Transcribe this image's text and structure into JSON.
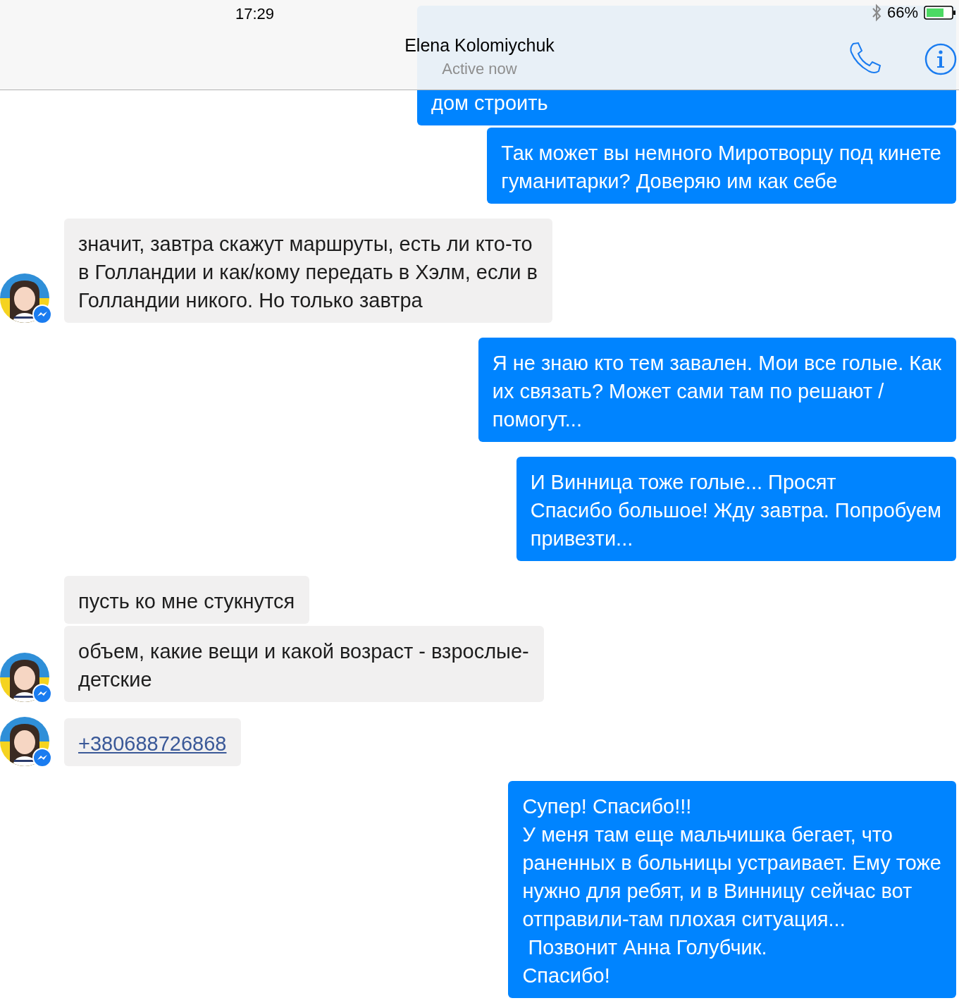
{
  "status_bar": {
    "time": "17:29",
    "battery": "66%"
  },
  "header": {
    "name": "Elena Kolomiychuk",
    "status": "Active now"
  },
  "groups": [
    {
      "kind": "outgoing",
      "messages": [
        {
          "kind": "text",
          "text": "дом строить"
        },
        {
          "kind": "text",
          "text": "Так может вы немного Миротворцу под кинете\nгуманитарки? Доверяю им как себе"
        }
      ]
    },
    {
      "kind": "incoming",
      "messages": [
        {
          "kind": "text",
          "text": "значит, завтра скажут маршруты, есть ли кто-то\nв Голландии и как/кому передать в Хэлм, если в\nГолландии никого. Но только завтра"
        }
      ]
    },
    {
      "kind": "outgoing",
      "messages": [
        {
          "kind": "text",
          "text": "Я не знаю кто тем завален. Мои все голые. Как\nих связать? Может сами там по решают /\nпомогут..."
        }
      ]
    },
    {
      "kind": "outgoing",
      "messages": [
        {
          "kind": "text",
          "text": "И Винница тоже голые... Просят\nСпасибо большое! Жду завтра. Попробуем\nпривезти..."
        }
      ]
    },
    {
      "kind": "incoming",
      "messages": [
        {
          "kind": "text",
          "text": "пусть ко мне стукнутся"
        },
        {
          "kind": "text",
          "text": "объем, какие вещи и какой возраст - взрослые-\nдетские"
        }
      ]
    },
    {
      "kind": "incoming",
      "messages": [
        {
          "kind": "link",
          "text": "+380688726868"
        }
      ]
    },
    {
      "kind": "outgoing",
      "messages": [
        {
          "kind": "text",
          "text": "Супер! Спасибо!!!\nУ меня там еще мальчишка бегает, что\nраненных в больницы устраивает. Ему тоже\nнужно для ребят, и в Винницу сейчас вот\nотправили-там плохая ситуация...\n Позвонит Анна Голубчик.\nСпасибо!"
        }
      ]
    }
  ]
}
